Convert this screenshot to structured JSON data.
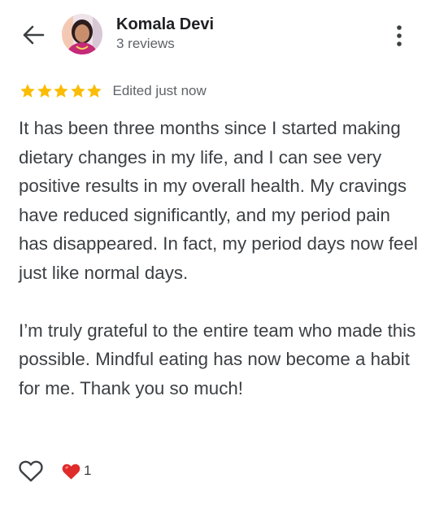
{
  "reviewer": {
    "name": "Komala Devi",
    "reviews_count": "3 reviews"
  },
  "rating": {
    "stars": 5,
    "max_stars": 5,
    "edited_label": "Edited just now",
    "star_color": "#fbbc04"
  },
  "review": {
    "paragraph_1": "It has been three months since I started making dietary changes in my life, and I can see very positive results in my overall health. My cravings have reduced significantly, and my period pain has disappeared. In fact, my period days now feel just like normal days.",
    "paragraph_2": "I’m truly grateful to the entire team who made this possible. Mindful eating has now become a habit for me. Thank you so much!"
  },
  "reactions": {
    "like_icon": "heart-outline-icon",
    "reaction_icon": "red-heart-emoji",
    "reaction_count": "1",
    "reaction_color": "#e02b2b"
  }
}
